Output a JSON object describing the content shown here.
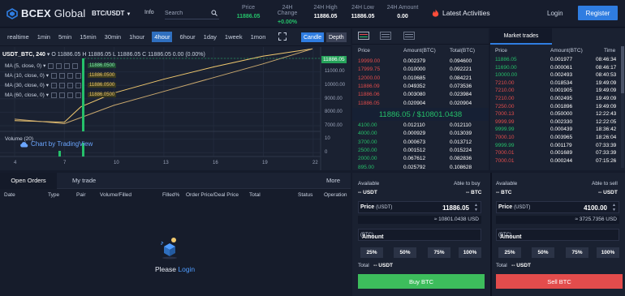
{
  "header": {
    "logo_text": "BCEX",
    "logo_suffix": " Global",
    "pair": "BTC/USDT",
    "info": "Info",
    "search_placeholder": "Search",
    "stats": [
      {
        "label": "Price",
        "value": "11886.05",
        "color": "#25c06a"
      },
      {
        "label": "24H Change",
        "value": "+0.00%",
        "color": "#25c06a"
      },
      {
        "label": "24H High",
        "value": "11886.05",
        "color": "#ffffff"
      },
      {
        "label": "24H Low",
        "value": "11886.05",
        "color": "#ffffff"
      },
      {
        "label": "24H Amount",
        "value": "0.00",
        "color": "#ffffff"
      }
    ],
    "activities": "Latest Activities",
    "login": "Login",
    "register": "Register"
  },
  "chart": {
    "timeframes": [
      "realtime",
      "1min",
      "5min",
      "15min",
      "30min",
      "1hour",
      "4hour",
      "6hour",
      "1day",
      "1week",
      "1mon"
    ],
    "active_timeframe": "4hour",
    "candle": "Candle",
    "depth": "Depth",
    "symbol": "USDT_BTC, 240",
    "ohlc": "O 11886.05 H 11886.05 L 11886.05 C 11886.05 0.00 (0.00%)",
    "ma": [
      {
        "label": "MA (5, close, 0)",
        "value": "11886.0500",
        "color": "#25c06a"
      },
      {
        "label": "MA (10, close, 0)",
        "value": "11886.0500",
        "color": "#f0c86e"
      },
      {
        "label": "MA (30, close, 0)",
        "value": "11886.0500",
        "color": "#f0c86e"
      },
      {
        "label": "MA (60, close, 0)",
        "value": "11886.0500",
        "color": "#f0c86e"
      }
    ],
    "price_label": "11886.05",
    "y_ticks": [
      "11000.00",
      "10000.00",
      "9000.00",
      "8000.00",
      "7000.00",
      "10",
      "0"
    ],
    "x_ticks": [
      "4",
      "7",
      "10",
      "13",
      "16",
      "19",
      "22"
    ],
    "volume": "Volume (20)",
    "tradingview": "Chart by TradingView"
  },
  "chart_data": {
    "type": "line",
    "x": [
      4,
      7,
      8,
      10,
      13,
      16,
      19,
      22
    ],
    "ylim": [
      6500,
      12000
    ],
    "series": [
      {
        "values": [
          7200,
          7100,
          8100,
          9000,
          9900,
          10700,
          11400,
          11886
        ]
      },
      {
        "values": [
          7300,
          7000,
          7400,
          8200,
          9100,
          10000,
          10900,
          11886
        ]
      }
    ]
  },
  "orders": {
    "tabs": [
      "Open Orders",
      "My trade"
    ],
    "more": "More",
    "columns": [
      "Date",
      "Type",
      "Pair",
      "Volume/Filled",
      "Filled%",
      "Order Price/Deal Price",
      "Total",
      "Status",
      "Operation"
    ],
    "please": "Please ",
    "login": "Login"
  },
  "orderbook": {
    "headers": [
      "Price",
      "Amount(BTC)",
      "Total(BTC)"
    ],
    "asks": [
      [
        "19999.00",
        "0.002379",
        "0.094600"
      ],
      [
        "17999.75",
        "0.010000",
        "0.092221"
      ],
      [
        "12000.00",
        "0.010685",
        "0.084221"
      ],
      [
        "11886.09",
        "0.049352",
        "0.073536"
      ],
      [
        "11886.06",
        "0.003080",
        "0.023984"
      ],
      [
        "11886.05",
        "0.020904",
        "0.020904"
      ]
    ],
    "mid_price": "11886.05",
    "mid_usd": "$10801.0438",
    "bids": [
      [
        "4100.00",
        "0.012110",
        "0.012110"
      ],
      [
        "4000.00",
        "0.000929",
        "0.013039"
      ],
      [
        "3700.00",
        "0.000673",
        "0.013712"
      ],
      [
        "2500.00",
        "0.001512",
        "0.015224"
      ],
      [
        "2000.00",
        "0.067612",
        "0.082836"
      ],
      [
        "895.00",
        "0.025792",
        "0.108628"
      ]
    ]
  },
  "market_trades": {
    "title": "Market trades",
    "headers": [
      "Price",
      "Amount(BTC)",
      "Time"
    ],
    "rows": [
      [
        "11886.05",
        "0.001977",
        "08:46:34",
        "g"
      ],
      [
        "11690.00",
        "0.000061",
        "08:46:17",
        "g"
      ],
      [
        "10000.00",
        "0.002493",
        "08:40:53",
        "g"
      ],
      [
        "7210.00",
        "0.018534",
        "19:49:09",
        "r"
      ],
      [
        "7210.00",
        "0.001905",
        "19:49:09",
        "r"
      ],
      [
        "7210.00",
        "0.002495",
        "19:49:09",
        "r"
      ],
      [
        "7250.00",
        "0.001896",
        "19:49:09",
        "r"
      ],
      [
        "7000.13",
        "0.050000",
        "12:22:43",
        "r"
      ],
      [
        "9999.99",
        "0.002330",
        "12:22:05",
        "r"
      ],
      [
        "9999.99",
        "0.000439",
        "18:36:42",
        "g"
      ],
      [
        "7000.10",
        "0.003965",
        "18:26:04",
        "r"
      ],
      [
        "9999.99",
        "0.001179",
        "07:33:39",
        "g"
      ],
      [
        "7000.01",
        "0.001689",
        "07:33:39",
        "r"
      ],
      [
        "7000.01",
        "0.000244",
        "07:15:26",
        "r"
      ]
    ]
  },
  "trade": {
    "buy": {
      "available": "Available",
      "avail_unit": "-- USDT",
      "able": "Able to buy",
      "able_val": "-- BTC",
      "price_label": "Price",
      "price_unit": "(USDT)",
      "price": "11886.05",
      "conv": "≈ 10801.0438 USD",
      "amount_label": "Amount",
      "amount_unit": "(BTC)",
      "pcts": [
        "25%",
        "50%",
        "75%",
        "100%"
      ],
      "total": "Total",
      "total_val": "-- USDT",
      "button": "Buy BTC"
    },
    "sell": {
      "available": "Available",
      "avail_unit": "-- BTC",
      "able": "Able to sell",
      "able_val": "-- USDT",
      "price_label": "Price",
      "price_unit": "(USDT)",
      "price": "4100.00",
      "conv": "≈ 3725.7356 USD",
      "amount_label": "Amount",
      "amount_unit": "(BTC)",
      "pcts": [
        "25%",
        "50%",
        "75%",
        "100%"
      ],
      "total": "Total",
      "total_val": "-- USDT",
      "button": "Sell BTC"
    }
  }
}
